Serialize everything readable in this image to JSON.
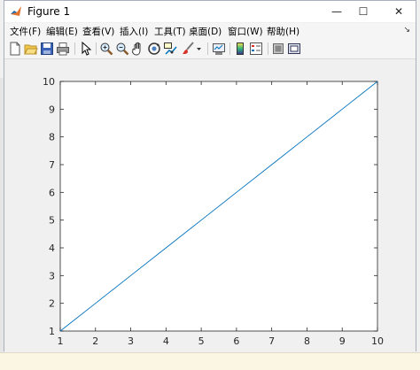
{
  "window": {
    "title": "Figure 1",
    "controls": {
      "minimize": "—",
      "maximize": "☐",
      "close": "✕"
    }
  },
  "menubar": {
    "items": [
      {
        "label": "文件(F)"
      },
      {
        "label": "编辑(E)"
      },
      {
        "label": "查看(V)"
      },
      {
        "label": "插入(I)"
      },
      {
        "label": "工具(T)"
      },
      {
        "label": "桌面(D)"
      },
      {
        "label": "窗口(W)"
      },
      {
        "label": "帮助(H)"
      }
    ]
  },
  "toolbar": {
    "buttons": [
      {
        "icon": "new-figure-icon"
      },
      {
        "icon": "open-file-icon"
      },
      {
        "icon": "save-icon"
      },
      {
        "icon": "print-icon"
      },
      {
        "icon": "pointer-icon"
      },
      {
        "icon": "zoom-in-icon"
      },
      {
        "icon": "zoom-out-icon"
      },
      {
        "icon": "pan-icon"
      },
      {
        "icon": "rotate-3d-icon"
      },
      {
        "icon": "data-cursor-icon"
      },
      {
        "icon": "brush-icon"
      },
      {
        "icon": "link-plot-icon"
      },
      {
        "icon": "colorbar-icon"
      },
      {
        "icon": "legend-icon"
      },
      {
        "icon": "hide-plot-tools-icon"
      },
      {
        "icon": "show-plot-tools-icon"
      }
    ]
  },
  "colors": {
    "axes_bg": "#ffffff",
    "figure_bg": "#f0f0f0",
    "line": "#0072bd",
    "axis": "#262626"
  },
  "chart_data": {
    "type": "line",
    "title": "",
    "xlabel": "",
    "ylabel": "",
    "xlim": [
      1,
      10
    ],
    "ylim": [
      1,
      10
    ],
    "xticks": [
      1,
      2,
      3,
      4,
      5,
      6,
      7,
      8,
      9,
      10
    ],
    "yticks": [
      1,
      2,
      3,
      4,
      5,
      6,
      7,
      8,
      9,
      10
    ],
    "series": [
      {
        "x": [
          1,
          2,
          3,
          4,
          5,
          6,
          7,
          8,
          9,
          10
        ],
        "y": [
          1,
          2,
          3,
          4,
          5,
          6,
          7,
          8,
          9,
          10
        ],
        "color": "#0072bd"
      }
    ]
  }
}
